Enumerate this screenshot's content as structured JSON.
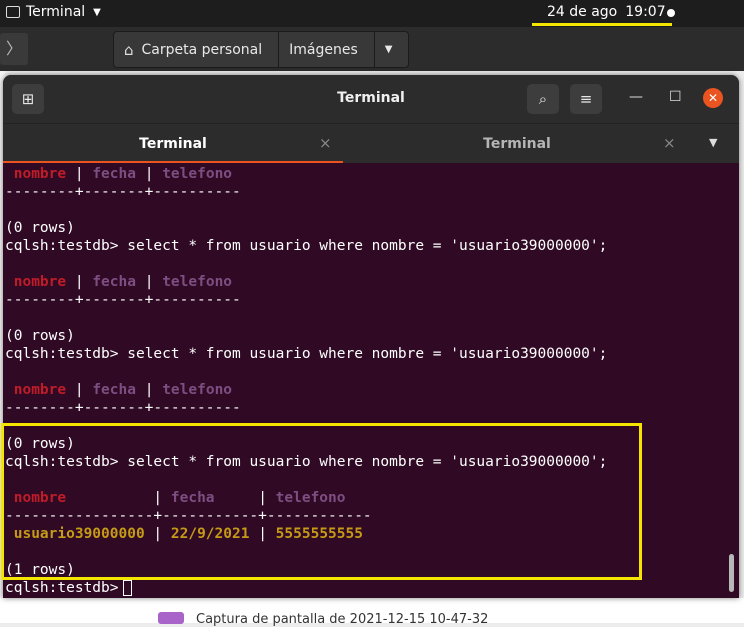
{
  "topbar": {
    "app_name": "Terminal",
    "date": "24 de ago",
    "time": "19:07"
  },
  "file_manager": {
    "crumbs": [
      "Carpeta personal",
      "Imágenes"
    ],
    "bottom_item": "Captura de pantalla de 2021-12-15 10-47-32"
  },
  "window": {
    "title": "Terminal",
    "tabs": [
      {
        "label": "Terminal",
        "active": true
      },
      {
        "label": "Terminal",
        "active": false
      }
    ]
  },
  "terminal": {
    "prompt": "cqlsh:testdb>",
    "query": "select * from usuario where nombre = 'usuario39000000';",
    "columns": [
      "nombre",
      "fecha",
      "telefono"
    ],
    "sep_short": "--------+-------+----------",
    "sep_long": "-----------------+-----------+------------",
    "result_row": [
      "usuario39000000",
      "22/9/2021",
      "5555555555"
    ],
    "zero_rows": "(0 rows)",
    "one_row": "(1 rows)"
  },
  "colors": {
    "accent": "#e95420",
    "terminal_bg": "#300a24",
    "highlight": "#f5e600"
  }
}
